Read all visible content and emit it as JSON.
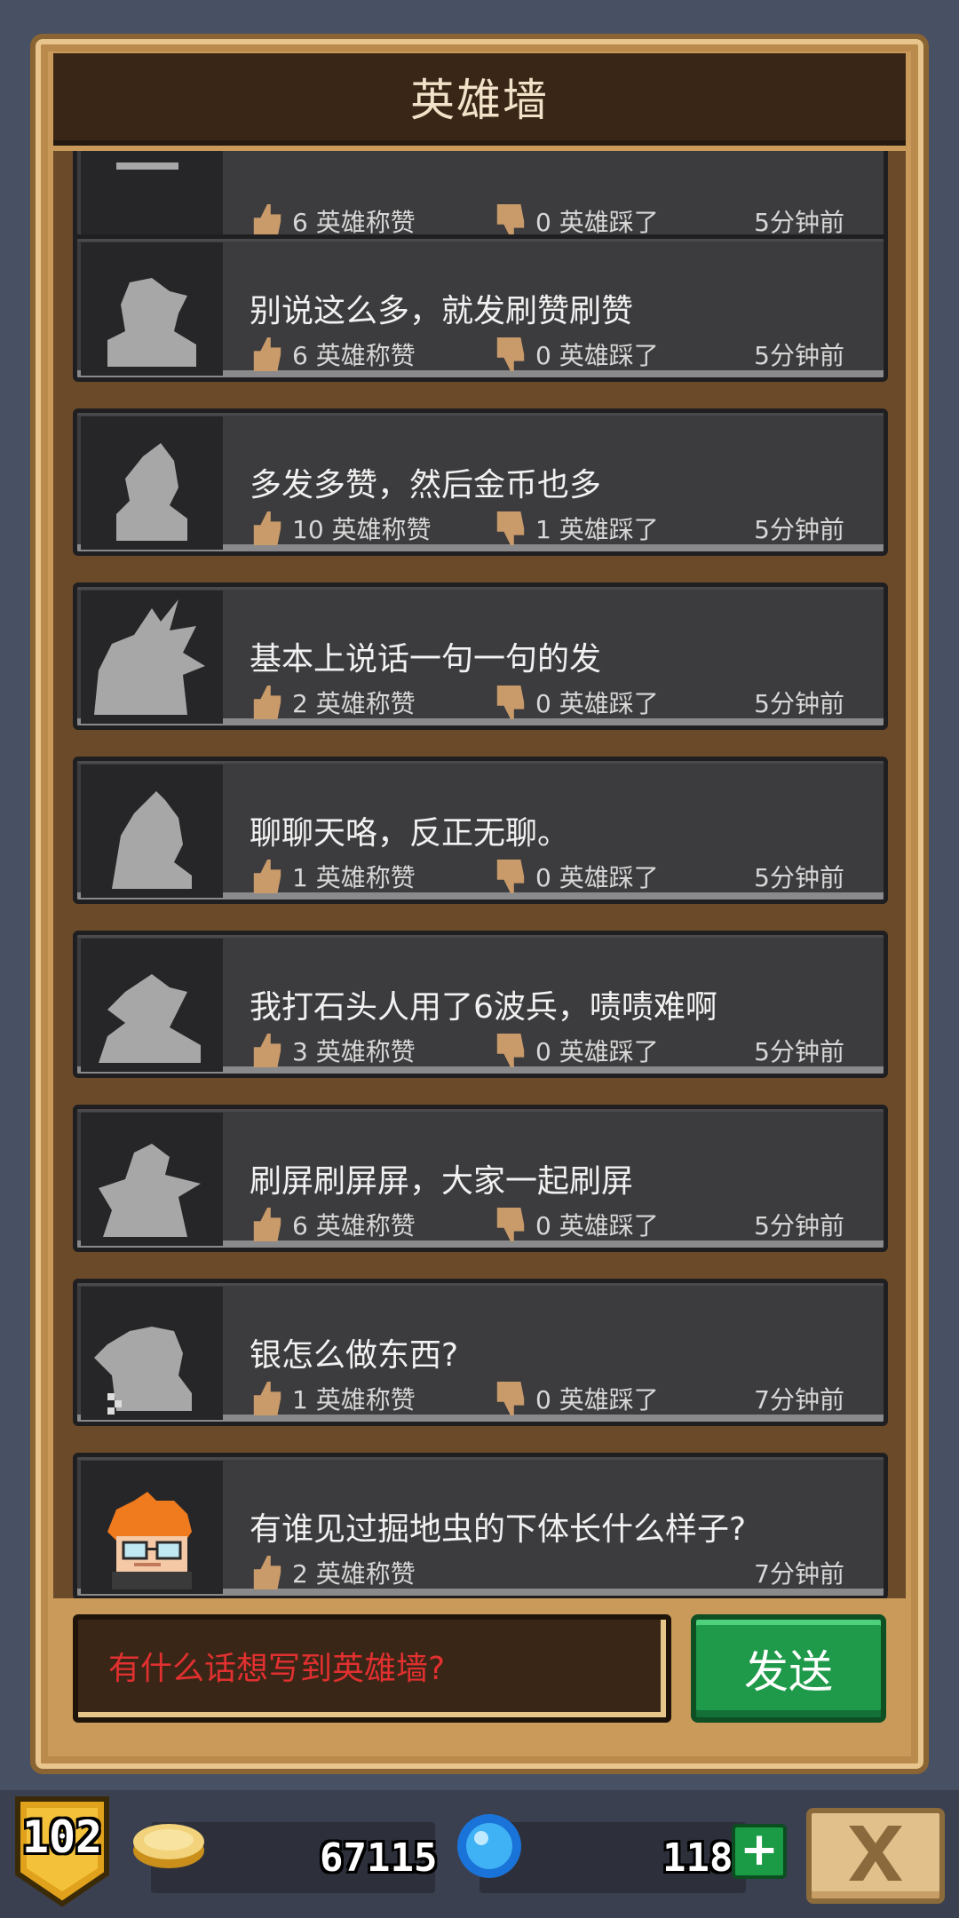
{
  "header": {
    "title": "英雄墙"
  },
  "posts": [
    {
      "message": "",
      "likes": "6 英雄称赞",
      "dislikes": "0 英雄踩了",
      "time": "5分钟前"
    },
    {
      "message": "别说这么多，就发刷赞刷赞",
      "likes": "6 英雄称赞",
      "dislikes": "0 英雄踩了",
      "time": "5分钟前"
    },
    {
      "message": "多发多赞，然后金币也多",
      "likes": "10 英雄称赞",
      "dislikes": "1 英雄踩了",
      "time": "5分钟前"
    },
    {
      "message": "基本上说话一句一句的发",
      "likes": "2 英雄称赞",
      "dislikes": "0 英雄踩了",
      "time": "5分钟前"
    },
    {
      "message": "聊聊天咯，反正无聊。",
      "likes": "1 英雄称赞",
      "dislikes": "0 英雄踩了",
      "time": "5分钟前"
    },
    {
      "message": "我打石头人用了6波兵，啧啧难啊",
      "likes": "3 英雄称赞",
      "dislikes": "0 英雄踩了",
      "time": "5分钟前"
    },
    {
      "message": "刷屏刷屏屏，大家一起刷屏",
      "likes": "6 英雄称赞",
      "dislikes": "0 英雄踩了",
      "time": "5分钟前"
    },
    {
      "message": "银怎么做东西?",
      "likes": "1 英雄称赞",
      "dislikes": "0 英雄踩了",
      "time": "7分钟前"
    },
    {
      "message": "有谁见过掘地虫的下体长什么样子?",
      "likes": "2 英雄称赞",
      "dislikes": "",
      "time": "7分钟前"
    }
  ],
  "compose": {
    "placeholder": "有什么话想写到英雄墙?",
    "send_label": "发送"
  },
  "status": {
    "level": "102",
    "gold": "67115",
    "gems": "118",
    "plus_label": "+"
  }
}
